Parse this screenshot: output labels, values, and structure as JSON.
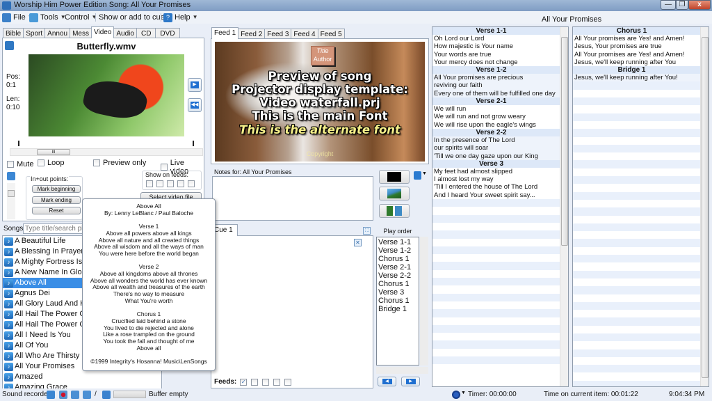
{
  "window": {
    "title": "Worship Him Power Edition Song: All Your Promises",
    "minimize": "—",
    "restore": "❐",
    "close": "x"
  },
  "menu": {
    "items": [
      {
        "label": "File",
        "icon": "file-icon"
      },
      {
        "label": "Tools",
        "icon": "tools-icon"
      },
      {
        "label": "Control",
        "icon": ""
      },
      {
        "label": "Show or add to cue",
        "icon": ""
      },
      {
        "label": "Help",
        "icon": "help-icon"
      }
    ]
  },
  "media_tabs": {
    "items": [
      "Bible",
      "Sport",
      "Annou",
      "Mess",
      "Video",
      "Audio",
      "CD",
      "DVD"
    ],
    "active": "Video"
  },
  "video": {
    "filename": "Butterfly.wmv",
    "pos_label": "Pos:",
    "pos_value": "0:1",
    "len_label": "Len:",
    "len_value": "0:10",
    "mute_label": "Mute",
    "loop_label": "Loop",
    "preview_only_label": "Preview only",
    "live_video_label": "Live video",
    "inout_label": "In+out points:",
    "mark_beginning": "Mark beginning",
    "mark_ending": "Mark ending",
    "reset": "Reset",
    "show_on_feeds_label": "Show on feeds:",
    "select_video_file": "Select video file",
    "scroll_thumb": "III"
  },
  "songs": {
    "label": "Songs",
    "search_placeholder": "Type title/search phrase",
    "items": [
      "A Beautiful Life",
      "A Blessing In Prayer",
      "A Mighty Fortress Is Our God",
      "A New Name In Glory",
      "Above All",
      "Agnus Dei",
      "All Glory Laud And Honor",
      "All Hail The Power Of Jesus' Name",
      "All Hail The Power Of Jesus' Name",
      "All I Need Is You",
      "All Of You",
      "All Who Are Thirsty",
      "All Your Promises",
      "Amazed",
      "Amazing Grace"
    ],
    "selected": "Above All"
  },
  "song_popup": {
    "lines": [
      "Above All",
      "By: Lenny LeBlanc / Paul Baloche",
      "",
      "Verse 1",
      "Above all powers above all kings",
      "Above all nature and all created things",
      "Above all wisdom and all the ways of man",
      "You were here before the world began",
      "",
      "Verse 2",
      "Above all kingdoms above all thrones",
      "Above all wonders the world has ever known",
      "Above all wealth and treasures of the earth",
      "There's no way to measure",
      "What You're worth",
      "",
      "Chorus 1",
      "Crucified laid behind a stone",
      "You lived to die rejected and alone",
      "Like a rose trampled on the ground",
      "You took the fall and thought of me",
      "Above all",
      "",
      "©1999 Integrity's Hosanna! Music\\LenSongs"
    ]
  },
  "feeds": {
    "tabs": [
      "Feed 1",
      "Feed 2",
      "Feed 3",
      "Feed 4",
      "Feed 5"
    ],
    "active": "Feed 1",
    "preview": {
      "title": "Title",
      "author": "Author",
      "main_lines": [
        "Preview of song",
        "Projector display template:",
        "Video waterfall.prj",
        "This is the main Font"
      ],
      "alternate_line": "This is the alternate font",
      "copyright": "Copyright"
    }
  },
  "notes": {
    "label": "Notes for: All Your Promises",
    "value": ""
  },
  "cue": {
    "tab": "Cue 1",
    "feeds_label": "Feeds:",
    "feeds_checked": [
      true,
      false,
      false,
      false,
      false
    ],
    "play_order_label": "Play order",
    "play_order": [
      "Verse 1-1",
      "Verse 1-2",
      "Chorus 1",
      "Verse 2-1",
      "Verse 2-2",
      "Chorus 1",
      "Verse 3",
      "Chorus 1",
      "Bridge 1"
    ]
  },
  "lyrics": {
    "song_title": "All Your Promises",
    "left_column": [
      {
        "heading": "Verse 1-1",
        "lines": [
          "Oh Lord our Lord",
          "How majestic is Your name",
          "Your words are true",
          "Your mercy does not change"
        ]
      },
      {
        "heading": "Verse 1-2",
        "lines": [
          "All Your promises are precious",
          "reviving our faith",
          "Every one of them will be fulfilled one day"
        ]
      },
      {
        "heading": "Verse 2-1",
        "lines": [
          "We will run",
          "We will run and not grow weary",
          "We will rise upon the eagle's wings"
        ]
      },
      {
        "heading": "Verse 2-2",
        "lines": [
          "In the presence of The Lord",
          "our spirits will soar",
          "'Till we one day gaze upon our King"
        ]
      },
      {
        "heading": "Verse 3",
        "lines": [
          "My feet had almost slipped",
          "I almost lost my way",
          "'Till I entered the house of The Lord",
          "And I heard Your sweet spirit say..."
        ]
      }
    ],
    "right_column": [
      {
        "heading": "Chorus 1",
        "lines": [
          "All Your promises are Yes! and Amen!",
          "Jesus, Your promises are true",
          "All Your promises are Yes! and Amen!",
          "Jesus, we'll keep running after You"
        ]
      },
      {
        "heading": "Bridge 1",
        "lines": [
          "Jesus, we'll keep running after You!"
        ]
      }
    ]
  },
  "status": {
    "sound_recorder_label": "Sound recorder",
    "slash": "/",
    "buffer": "Buffer empty",
    "timer": "Timer: 00:00:00",
    "time_on_item": "Time on current item: 00:01:22",
    "clock": "9:04:34 PM"
  }
}
